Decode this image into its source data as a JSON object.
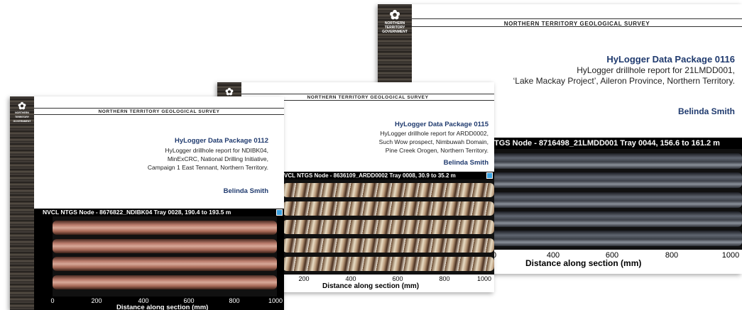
{
  "covers": [
    {
      "id": "p0116",
      "survey": "NORTHERN TERRITORY GEOLOGICAL SURVEY",
      "package": "HyLogger Data Package 0116",
      "description": [
        "HyLogger drillhole report for 21LMDD001,",
        "‘Lake Mackay Project’, Aileron Province, Northern Territory."
      ],
      "author": "Belinda Smith",
      "tray_title": "TGS Node  -  8716498_21LMDD001  Tray 0044,  156.6 to 161.2 m",
      "xticks": [
        "0",
        "400",
        "600",
        "800",
        "1000"
      ],
      "xlabel": "Distance along section (mm)",
      "logo": "NORTHERN TERRITORY GOVERNMENT"
    },
    {
      "id": "p0115",
      "survey": "NORTHERN TERRITORY GEOLOGICAL SURVEY",
      "package": "HyLogger Data Package 0115",
      "description": [
        "HyLogger drillhole report for ARDD0002,",
        "Such Wow prospect,  Nimbuwah Domain,",
        "Pine Creek Orogen, Northern Territory."
      ],
      "author": "Belinda Smith",
      "tray_title": "VCL NTGS Node  -  8636109_ARDD0002  Tray 0008,  30.9 to 35.2 m",
      "xticks": [
        "200",
        "400",
        "600",
        "800",
        "1000"
      ],
      "xlabel": "Distance along section (mm)",
      "logo": "NORTHERN TERRITORY GOVERNMENT"
    },
    {
      "id": "p0112",
      "survey": "NORTHERN TERRITORY GEOLOGICAL SURVEY",
      "package": "HyLogger Data Package 0112",
      "description": [
        "HyLogger drillhole report for NDIBK04,",
        "MinExCRC, National Drilling Initiative,",
        "Campaign 1 East Tennant, Northern Territory."
      ],
      "author": "Belinda Smith",
      "tray_title": "NVCL NTGS Node  -  8676822_NDIBK04  Tray 0028,  190.4 to 193.5 m",
      "xticks": [
        "0",
        "200",
        "400",
        "600",
        "800",
        "1000"
      ],
      "xlabel": "Distance along section (mm)",
      "logo": "NORTHERN TERRITORY GOVERNMENT"
    }
  ]
}
